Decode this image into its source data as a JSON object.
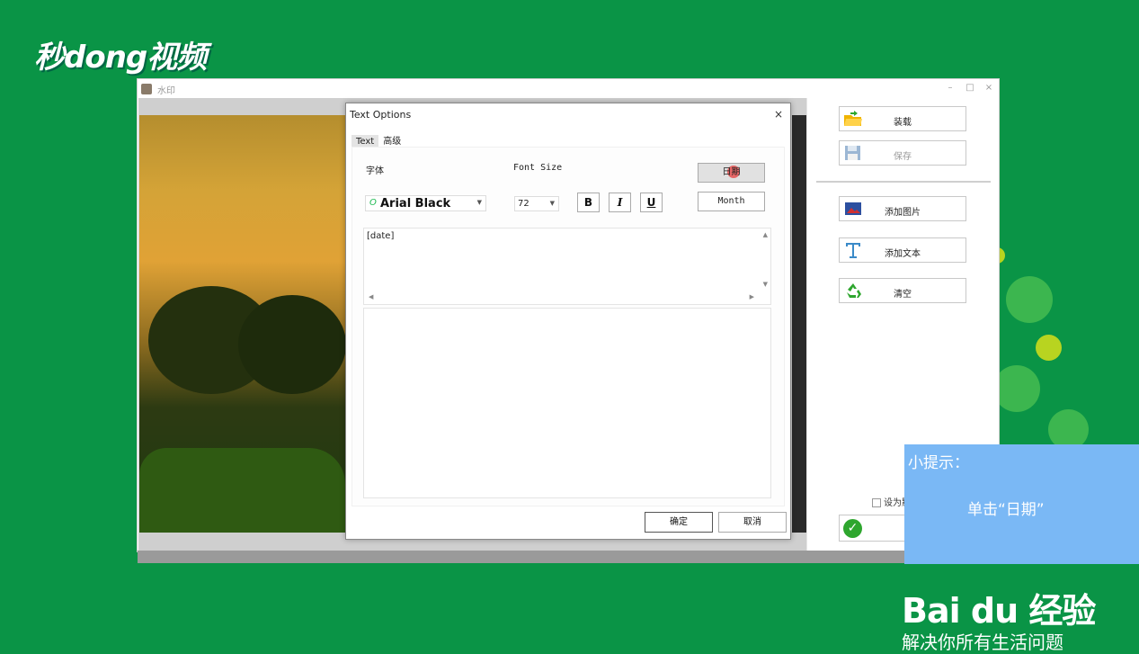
{
  "brand": {
    "logo_text": "秒dong视频"
  },
  "app_window": {
    "title": "水印",
    "controls": {
      "minimize": "–",
      "maximize": "□",
      "close": "×"
    }
  },
  "right_panel": {
    "load_label": "装载",
    "save_label": "保存",
    "add_image_label": "添加图片",
    "add_text_label": "添加文本",
    "clear_label": "清空",
    "default_checkbox_label": "设为默",
    "confirm_icon": "✓"
  },
  "dialog": {
    "title": "Text Options",
    "close": "×",
    "tabs": [
      {
        "label": "Text",
        "active": true
      },
      {
        "label": "高级",
        "active": false
      }
    ],
    "font_label": "字体",
    "font_size_label": "Font Size",
    "font_value": "Arial Black",
    "font_glyph": "O",
    "font_size_value": "72",
    "bold": "B",
    "italic": "I",
    "underline": "U",
    "date_button": "日期",
    "month_button": "Month",
    "text_value": "[date]",
    "ok_label": "确定",
    "cancel_label": "取消"
  },
  "hint": {
    "heading": "小提示：",
    "body": "单击“日期”"
  },
  "footer_brand": {
    "logo": "Bai du 经验",
    "slogan": "解决你所有生活问题"
  },
  "colors": {
    "background": "#0a9446",
    "hint_box": "#7ab8f5",
    "cursor_highlight": "#e63c3c"
  }
}
